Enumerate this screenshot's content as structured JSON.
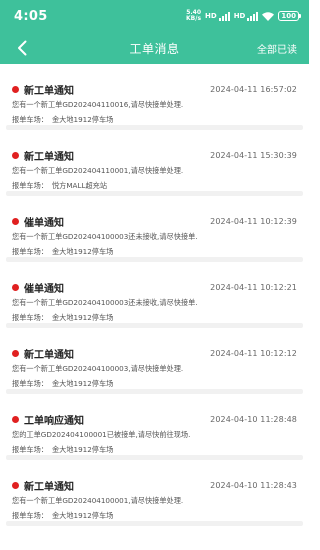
{
  "status_bar": {
    "time": "4:05",
    "net_speed_value": "5.40",
    "net_speed_unit": "KB/s",
    "signal_label": "HD",
    "battery": "100"
  },
  "nav": {
    "title": "工单消息",
    "read_all_label": "全部已读"
  },
  "lot_label": "报单车场：",
  "messages": [
    {
      "title": "新工单通知",
      "time": "2024-04-11 16:57:02",
      "body": "您有一个新工单GD202404110016,请尽快接单处理.",
      "lot": "金大地1912停车场"
    },
    {
      "title": "新工单通知",
      "time": "2024-04-11 15:30:39",
      "body": "您有一个新工单GD202404110001,请尽快接单处理.",
      "lot": "悦方MALL超充站"
    },
    {
      "title": "催单通知",
      "time": "2024-04-11 10:12:39",
      "body": "您有一个新工单GD202404100003还未接收,请尽快接单.",
      "lot": "金大地1912停车场"
    },
    {
      "title": "催单通知",
      "time": "2024-04-11 10:12:21",
      "body": "您有一个新工单GD202404100003还未接收,请尽快接单.",
      "lot": "金大地1912停车场"
    },
    {
      "title": "新工单通知",
      "time": "2024-04-11 10:12:12",
      "body": "您有一个新工单GD202404100003,请尽快接单处理.",
      "lot": "金大地1912停车场"
    },
    {
      "title": "工单响应通知",
      "time": "2024-04-10 11:28:48",
      "body": "您的工单GD202404100001已被接单,请尽快前往现场.",
      "lot": "金大地1912停车场"
    },
    {
      "title": "新工单通知",
      "time": "2024-04-10 11:28:43",
      "body": "您有一个新工单GD202404100001,请尽快接单处理.",
      "lot": "金大地1912停车场"
    }
  ],
  "colors": {
    "header": "#3ec19b",
    "unread_dot": "#e02020"
  }
}
